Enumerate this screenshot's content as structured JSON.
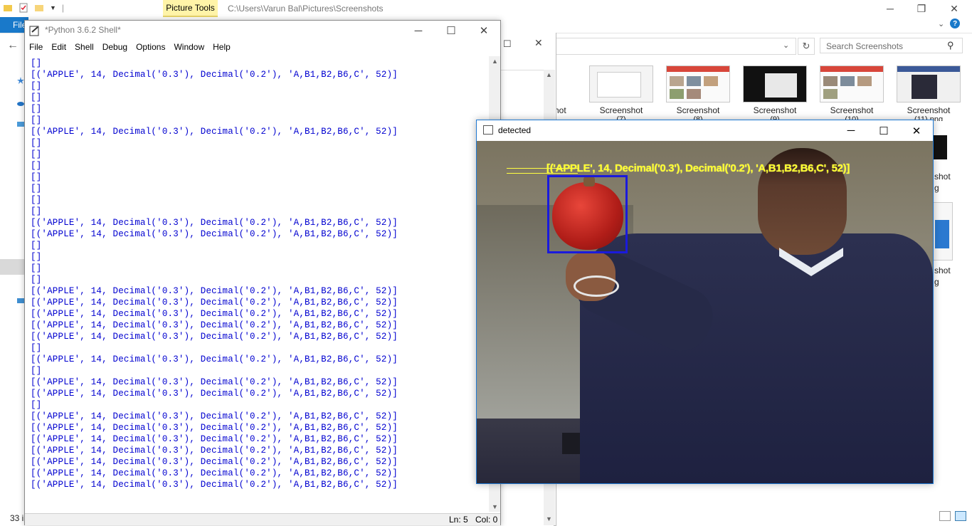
{
  "explorer": {
    "picture_tools_tab": "Picture Tools",
    "path": "C:\\Users\\Varun Bal\\Pictures\\Screenshots",
    "file_tab": "File",
    "search_placeholder": "Search Screenshots",
    "item_count": "33 i",
    "thumbnails": [
      {
        "label": "Screenshot",
        "sub": "(7)"
      },
      {
        "label": "Screenshot",
        "sub": "(8)"
      },
      {
        "label": "Screenshot",
        "sub": "(9)"
      },
      {
        "label": "Screenshot",
        "sub": "(10)"
      },
      {
        "label": "Screenshot",
        "sub": "(11).png"
      }
    ],
    "partial_labels": [
      "hot",
      "shot",
      "g",
      "shot",
      "g"
    ]
  },
  "shell": {
    "title": "*Python 3.6.2 Shell*",
    "menu": [
      "File",
      "Edit",
      "Shell",
      "Debug",
      "Options",
      "Window",
      "Help"
    ],
    "empty_line": "[]",
    "result_line": "[('APPLE', 14, Decimal('0.3'), Decimal('0.2'), 'A,B1,B2,B6,C', 52)]",
    "lines": [
      "[]",
      "R",
      "[]",
      "[]",
      "[]",
      "[]",
      "R",
      "[]",
      "[]",
      "[]",
      "[]",
      "[]",
      "[]",
      "[]",
      "R",
      "R",
      "[]",
      "[]",
      "[]",
      "[]",
      "R",
      "R",
      "R",
      "R",
      "R",
      "[]",
      "R",
      "[]",
      "R",
      "R",
      "[]",
      "R",
      "R",
      "R",
      "R",
      "R",
      "R",
      "R"
    ],
    "status_ln": "Ln: 5",
    "status_col": "Col: 0"
  },
  "detected": {
    "title": "detected",
    "overlay_text": "[('APPLE', 14, Decimal('0.3'), Decimal('0.2'), 'A,B1,B2,B6,C', 52)]"
  },
  "icons": {
    "minimize": "minimize-icon",
    "maximize": "maximize-icon",
    "close": "close-icon",
    "search": "search-icon",
    "refresh": "refresh-icon",
    "help": "help-icon"
  },
  "colors": {
    "shell_text": "#0000d0",
    "overlay_text": "#ffff30",
    "bbox": "#1a1adc",
    "file_tab": "#1979ca",
    "picture_tools": "#fff4a8"
  }
}
